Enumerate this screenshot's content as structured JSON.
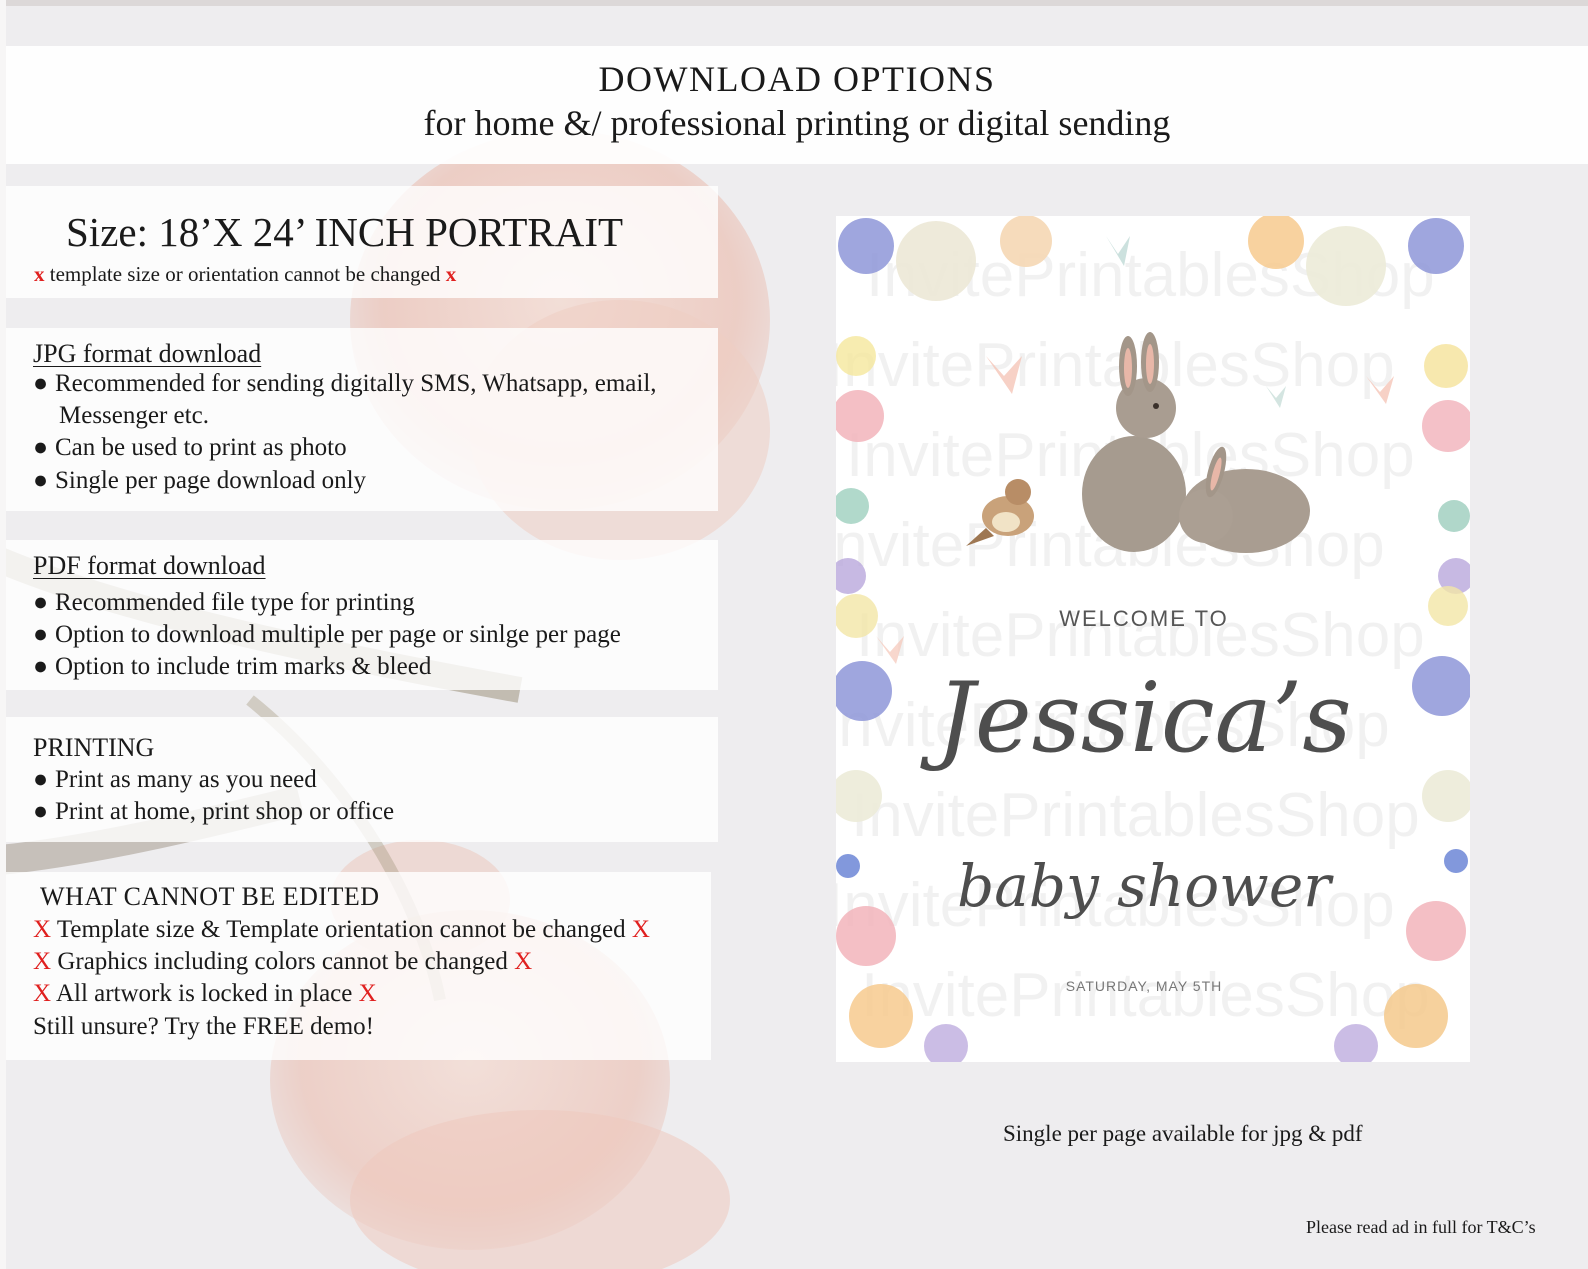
{
  "header": {
    "title": "DOWNLOAD OPTIONS",
    "subtitle": "for home &/ professional printing or digital sending"
  },
  "size_section": {
    "title": "Size: 18’X 24’ INCH PORTRAIT",
    "mark": "x",
    "note": "template size or orientation cannot be changed"
  },
  "jpg_section": {
    "title": "JPG format download",
    "bullets": [
      "Recommended for sending digitally SMS, Whatsapp, email,",
      "Can be used to print as photo",
      "Single per page download only"
    ],
    "continuation": "Messenger etc.",
    "bullet_glyph": "●"
  },
  "pdf_section": {
    "title": "PDF format download",
    "bullets": [
      "Recommended file type for printing",
      "Option to download multiple per page or sinlge per page",
      "Option to include trim marks & bleed"
    ]
  },
  "printing_section": {
    "title": "PRINTING",
    "bullets": [
      "Print as many as you need",
      "Print at home, print shop or office"
    ]
  },
  "cannot_section": {
    "title": "WHAT CANNOT BE EDITED",
    "mark": "X",
    "items": [
      "Template size & Template orientation cannot be changed",
      "Graphics including colors cannot be changed",
      "All artwork is locked in place"
    ],
    "footer": "Still unsure? Try the FREE demo!"
  },
  "poster": {
    "welcome": "WELCOME TO",
    "name": "Jessica’s",
    "event": "baby shower",
    "date": "SATURDAY, MAY 5TH",
    "watermark": "InvitePrintablesShop"
  },
  "caption": "Single per page available for jpg & pdf",
  "footer_note": "Please read ad in full for T&C’s"
}
